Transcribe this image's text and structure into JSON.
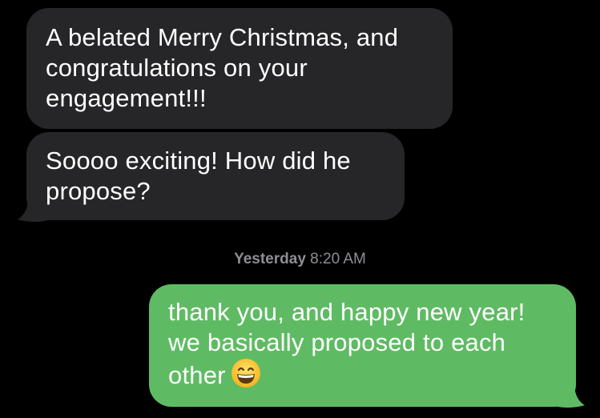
{
  "conversation": {
    "messages": [
      {
        "direction": "received",
        "lines": [
          "A belated Merry Christmas, and",
          "congratulations on your",
          "engagement!!!"
        ]
      },
      {
        "direction": "received",
        "lines": [
          "Soooo exciting! How did he",
          "propose?"
        ]
      },
      {
        "direction": "sent",
        "lines": [
          "thank you, and happy new year!",
          "we basically proposed to each",
          "other"
        ],
        "trailing_emoji": "grinning-face-with-smiling-eyes"
      }
    ],
    "timestamp": {
      "day": "Yesterday",
      "time": "8:20 AM"
    }
  },
  "colors": {
    "background": "#000000",
    "received_bubble": "#262628",
    "sent_bubble": "#5fbb63",
    "timestamp_text": "#8e8e93"
  }
}
